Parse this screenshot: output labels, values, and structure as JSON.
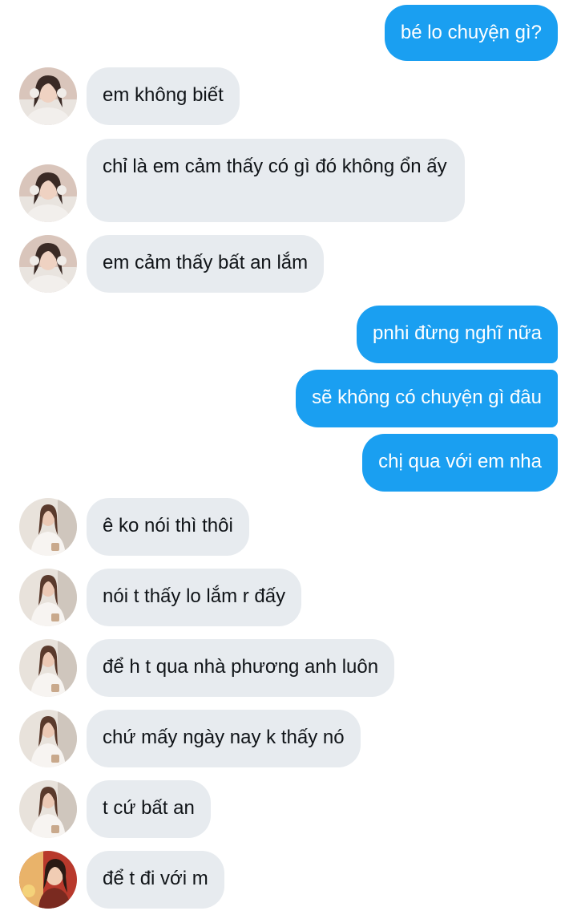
{
  "colors": {
    "outgoing_bubble": "#1a9ff1",
    "incoming_bubble": "#e7ebef",
    "outgoing_text": "#ffffff",
    "incoming_text": "#101418"
  },
  "messages": [
    {
      "direction": "outgoing",
      "text": "bé lo chuyện gì?"
    },
    {
      "direction": "incoming",
      "sender": "contact-a",
      "text": "em không biết"
    },
    {
      "direction": "incoming",
      "sender": "contact-a",
      "text": "chỉ là em cảm thấy có gì đó không ổn ấy"
    },
    {
      "direction": "incoming",
      "sender": "contact-a",
      "text": "em cảm thấy bất an lắm"
    },
    {
      "direction": "outgoing",
      "text": "pnhi đừng nghĩ nữa"
    },
    {
      "direction": "outgoing",
      "text": "sẽ không có chuyện gì đâu"
    },
    {
      "direction": "outgoing",
      "text": "chị qua với em nha"
    },
    {
      "direction": "incoming",
      "sender": "contact-b",
      "text": "ê ko nói thì thôi"
    },
    {
      "direction": "incoming",
      "sender": "contact-b",
      "text": "nói t thấy lo lắm r đấy"
    },
    {
      "direction": "incoming",
      "sender": "contact-b",
      "text": "để h t qua nhà phương anh luôn"
    },
    {
      "direction": "incoming",
      "sender": "contact-b",
      "text": "chứ mấy ngày nay k thấy nó"
    },
    {
      "direction": "incoming",
      "sender": "contact-b",
      "text": "t cứ bất an"
    },
    {
      "direction": "incoming",
      "sender": "contact-c",
      "text": "để t đi với m"
    }
  ]
}
